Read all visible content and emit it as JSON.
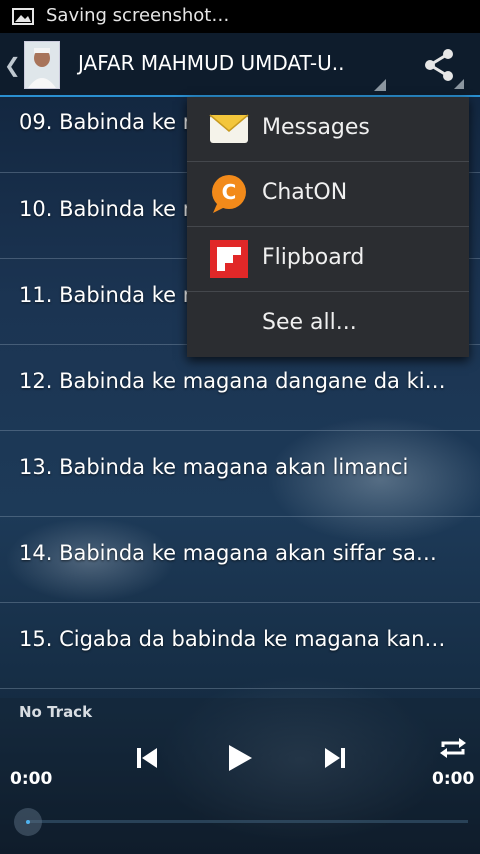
{
  "status_bar": {
    "text": "Saving screenshot…",
    "icon": "image-icon"
  },
  "action_bar": {
    "title": "JAFAR MAHMUD UMDAT-U..",
    "back_icon": "chevron-left-icon",
    "share_icon": "share-icon",
    "accent_color": "#2a8fd0"
  },
  "tracks": [
    {
      "label": "09. Babinda ke m"
    },
    {
      "label": "10. Babinda ke m"
    },
    {
      "label": "11. Babinda ke m"
    },
    {
      "label": "12. Babinda ke magana dangane da ki…"
    },
    {
      "label": "13. Babinda ke magana akan limanci"
    },
    {
      "label": "14. Babinda ke magana akan siffar sa…"
    },
    {
      "label": "15. Cigaba da babinda ke magana kan…"
    }
  ],
  "share_menu": {
    "items": [
      {
        "label": "Messages",
        "icon": "messages-icon"
      },
      {
        "label": "ChatON",
        "icon": "chaton-icon"
      },
      {
        "label": "Flipboard",
        "icon": "flipboard-icon"
      },
      {
        "label": "See all..."
      }
    ]
  },
  "player": {
    "now_playing": "No Track",
    "elapsed": "0:00",
    "duration": "0:00",
    "progress": 0
  }
}
